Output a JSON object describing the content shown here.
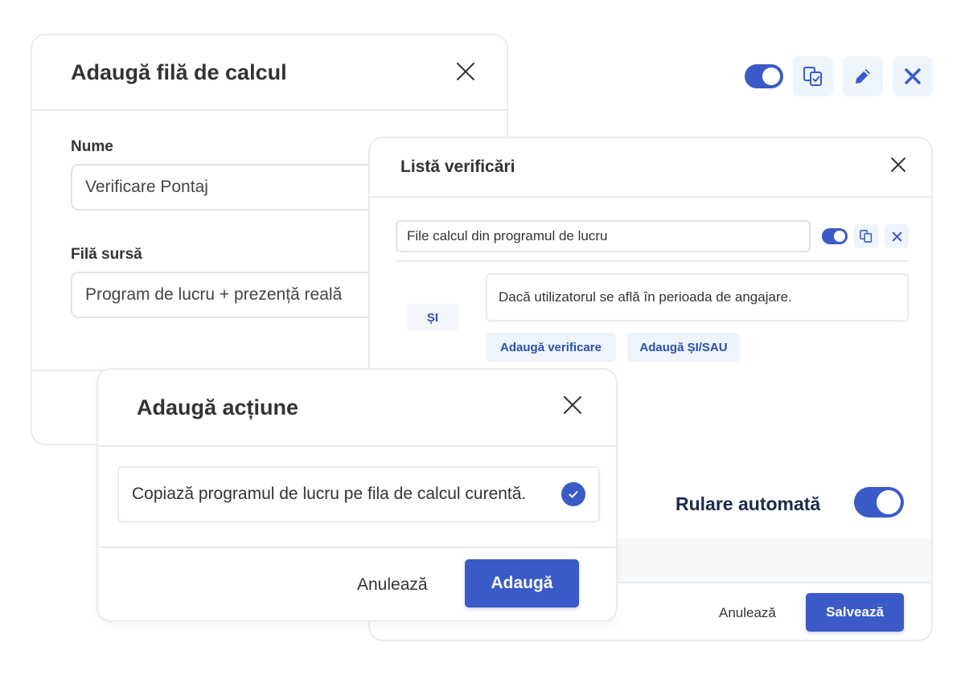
{
  "sheet_dialog": {
    "title": "Adaugă filă de calcul",
    "name_label": "Nume",
    "name_value": "Verificare Pontaj",
    "source_label": "Filă sursă",
    "source_value": "Program de lucru + prezență reală"
  },
  "toolbar": {
    "icons": [
      "toggle-on",
      "copy-icon",
      "pencil-icon",
      "close-icon"
    ],
    "accent_color": "#3a5bc7"
  },
  "checklist_dialog": {
    "title": "Listă verificări",
    "condition_group_value": "File calcul din programul de lucru",
    "and_label": "ȘI",
    "condition_text": "Dacă utilizatorul se află în perioada de angajare.",
    "add_check_label": "Adaugă verificare",
    "add_and_or_label": "Adaugă ȘI/SAU",
    "auto_run_label": "Rulare automată",
    "cancel_label": "Anulează",
    "save_label": "Salvează"
  },
  "action_dialog": {
    "title": "Adaugă acțiune",
    "action_item": "Copiază programul de lucru pe fila de calcul curentă.",
    "cancel_label": "Anulează",
    "add_label": "Adaugă"
  }
}
